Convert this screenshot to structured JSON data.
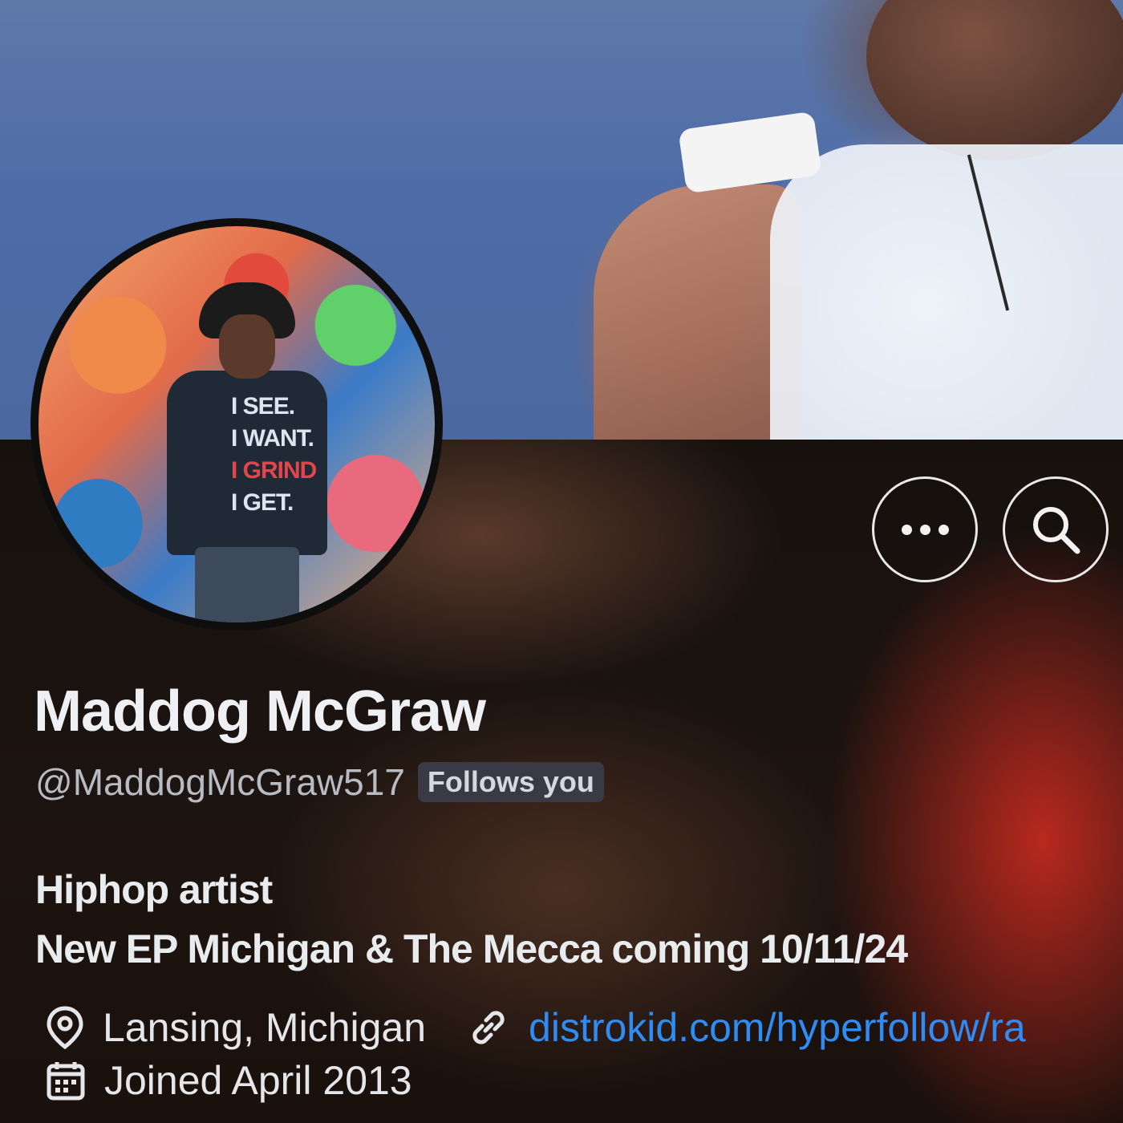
{
  "profile": {
    "display_name": "Maddog McGraw",
    "handle": "@MaddogMcGraw517",
    "follows_badge": "Follows you",
    "bio_line1": "Hiphop artist",
    "bio_line2": "New EP Michigan & The Mecca coming 10/11/24",
    "location": "Lansing, Michigan",
    "website": "distrokid.com/hyperfollow/ra",
    "joined": "Joined April 2013",
    "avatar_shirt_text": [
      "I SEE.",
      "I WANT.",
      "I GRIND",
      "I GET."
    ]
  },
  "actions": {
    "more_icon": "more-horizontal-icon",
    "search_icon": "search-icon"
  },
  "icons": {
    "location": "location-pin-icon",
    "link": "link-icon",
    "calendar": "calendar-icon"
  },
  "colors": {
    "link": "#2f8cf4",
    "badge_bg": "#3a3a46",
    "text_primary": "#eef0f3",
    "text_secondary": "#b8bcc2"
  }
}
